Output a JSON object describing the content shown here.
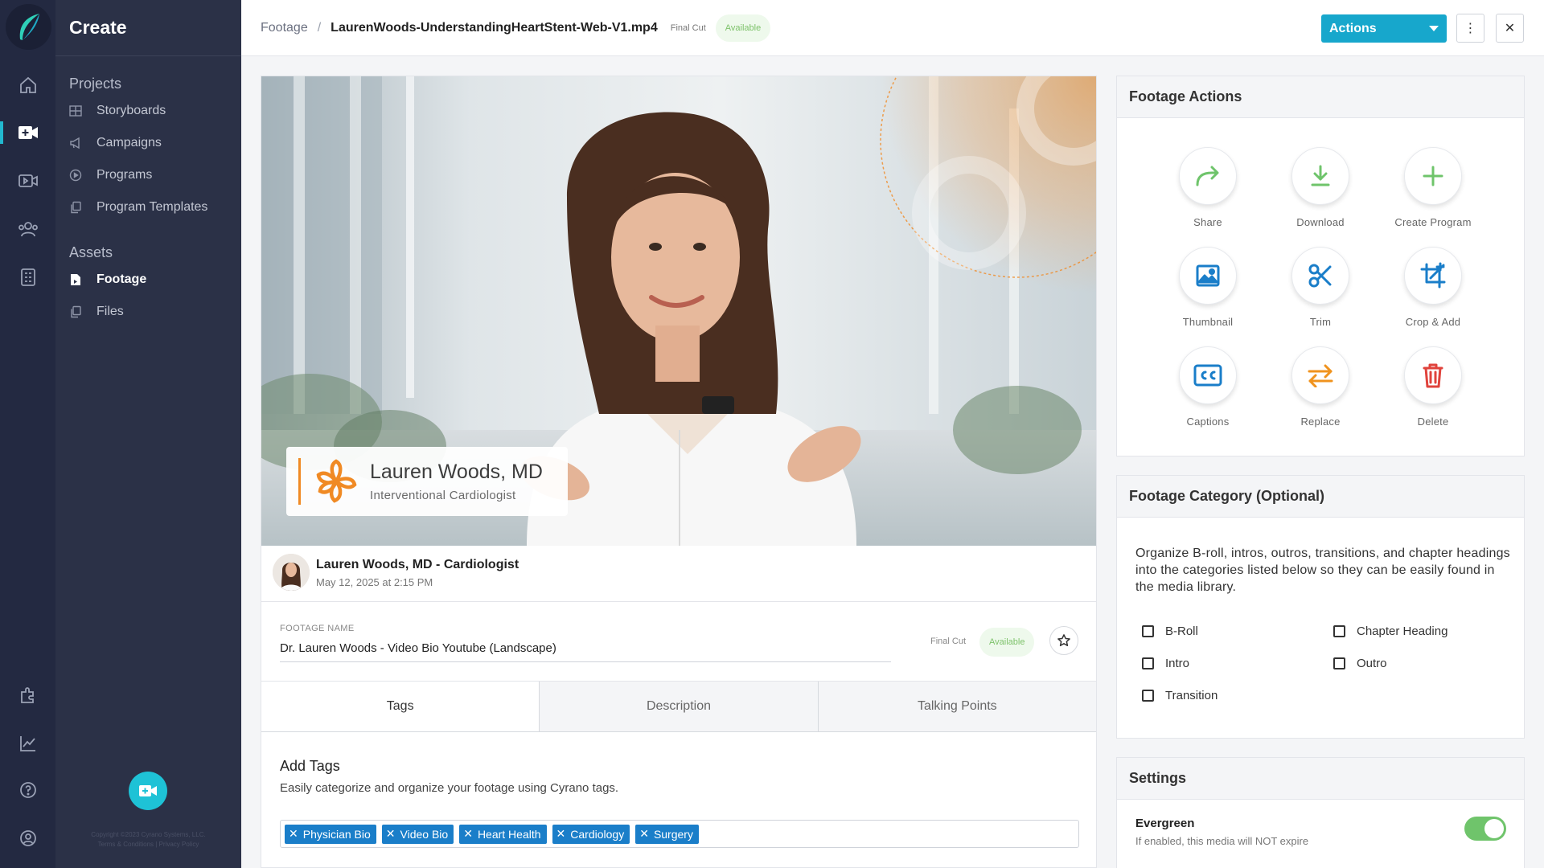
{
  "sidebar": {
    "title": "Create",
    "groups": [
      {
        "label": "Projects",
        "items": [
          "Storyboards",
          "Campaigns",
          "Programs",
          "Program Templates"
        ]
      },
      {
        "label": "Assets",
        "items": [
          "Footage",
          "Files"
        ]
      }
    ],
    "active_item": "Footage",
    "copyright": "Copyright ©2023 Cyrano Systems, LLC.",
    "legal": "Terms & Conditions | Privacy Policy"
  },
  "header": {
    "breadcrumb_root": "Footage",
    "breadcrumb_sep": "/",
    "file_name": "LaurenWoods-UnderstandingHeartStent-Web-V1.mp4",
    "stage": "Final Cut",
    "status": "Available",
    "actions_label": "Actions",
    "more_icon": "⋮",
    "close_icon": "✕"
  },
  "video": {
    "lower_third_name": "Lauren Woods, MD",
    "lower_third_role": "Interventional Cardiologist",
    "brand_color": "#f08a24"
  },
  "owner": {
    "name": "Lauren Woods,  MD - Cardiologist",
    "date": "May 12, 2025 at 2:15 PM"
  },
  "footage": {
    "name_label": "FOOTAGE NAME",
    "name_value": "Dr. Lauren Woods  - Video Bio Youtube (Landscape)",
    "stage": "Final Cut",
    "status": "Available"
  },
  "tabs": [
    "Tags",
    "Description",
    "Talking Points"
  ],
  "active_tab": "Tags",
  "tags_section": {
    "title": "Add Tags",
    "description": "Easily categorize and organize your footage using Cyrano tags.",
    "tags": [
      "Physician Bio",
      "Video Bio",
      "Heart Health",
      "Cardiology",
      "Surgery"
    ],
    "tag_color": "#1a7ec9"
  },
  "footage_actions": {
    "title": "Footage Actions",
    "items": [
      {
        "label": "Share",
        "icon": "share-icon",
        "color": "#6fc46b"
      },
      {
        "label": "Download",
        "icon": "download-icon",
        "color": "#6fc46b"
      },
      {
        "label": "Create Program",
        "icon": "plus-icon",
        "color": "#6fc46b"
      },
      {
        "label": "Thumbnail",
        "icon": "image-icon",
        "color": "#1a7ec9"
      },
      {
        "label": "Trim",
        "icon": "scissors-icon",
        "color": "#1a7ec9"
      },
      {
        "label": "Crop & Add",
        "icon": "crop-add-icon",
        "color": "#1a7ec9"
      },
      {
        "label": "Captions",
        "icon": "captions-icon",
        "color": "#1a7ec9"
      },
      {
        "label": "Replace",
        "icon": "replace-icon",
        "color": "#f0931e"
      },
      {
        "label": "Delete",
        "icon": "trash-icon",
        "color": "#e0433c"
      }
    ]
  },
  "footage_category": {
    "title": "Footage Category (Optional)",
    "description": "Organize B-roll, intros, outros, transitions, and chapter headings into the categories listed below so they can be easily found in the media library.",
    "options": [
      "B-Roll",
      "Chapter Heading",
      "Intro",
      "Outro",
      "Transition"
    ]
  },
  "settings": {
    "title": "Settings",
    "evergreen_label": "Evergreen",
    "evergreen_desc": "If enabled, this media will NOT expire",
    "evergreen_on": true
  }
}
